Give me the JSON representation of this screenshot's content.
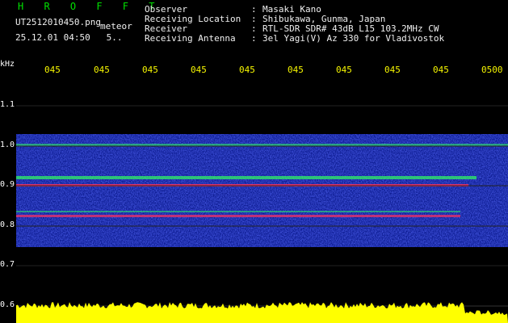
{
  "header": {
    "title": "H R O F F T",
    "filename": "UT2512010450.png",
    "mode": "meteor",
    "time": "25.12.01 04:50",
    "interval": "5.."
  },
  "meta": [
    {
      "label": "Observer",
      "value": "Masaki Kano"
    },
    {
      "label": "Receiving Location",
      "value": "Shibukawa, Gunma, Japan"
    },
    {
      "label": "Receiver",
      "value": "RTL-SDR SDR# 43dB L15 103.2MHz CW"
    },
    {
      "label": "Receiving Antenna",
      "value": "3el Yagi(V) Az 330 for Vladivostok"
    }
  ],
  "axes": {
    "unit": "kHz",
    "time_ticks": [
      "045",
      "045",
      "045",
      "045",
      "045",
      "045",
      "045",
      "045",
      "045",
      "0500"
    ],
    "freq_ticks": [
      "1.1",
      "1.0",
      "0.9",
      "0.8",
      "0.7",
      "0.6"
    ]
  },
  "colors": {
    "background": "#000000",
    "band_blue": "#1a33ff",
    "signal_green": "#30ff60",
    "signal_red": "#ff3060",
    "noise_yellow": "#ffff00",
    "tick_yellow": "#f6f600"
  }
}
